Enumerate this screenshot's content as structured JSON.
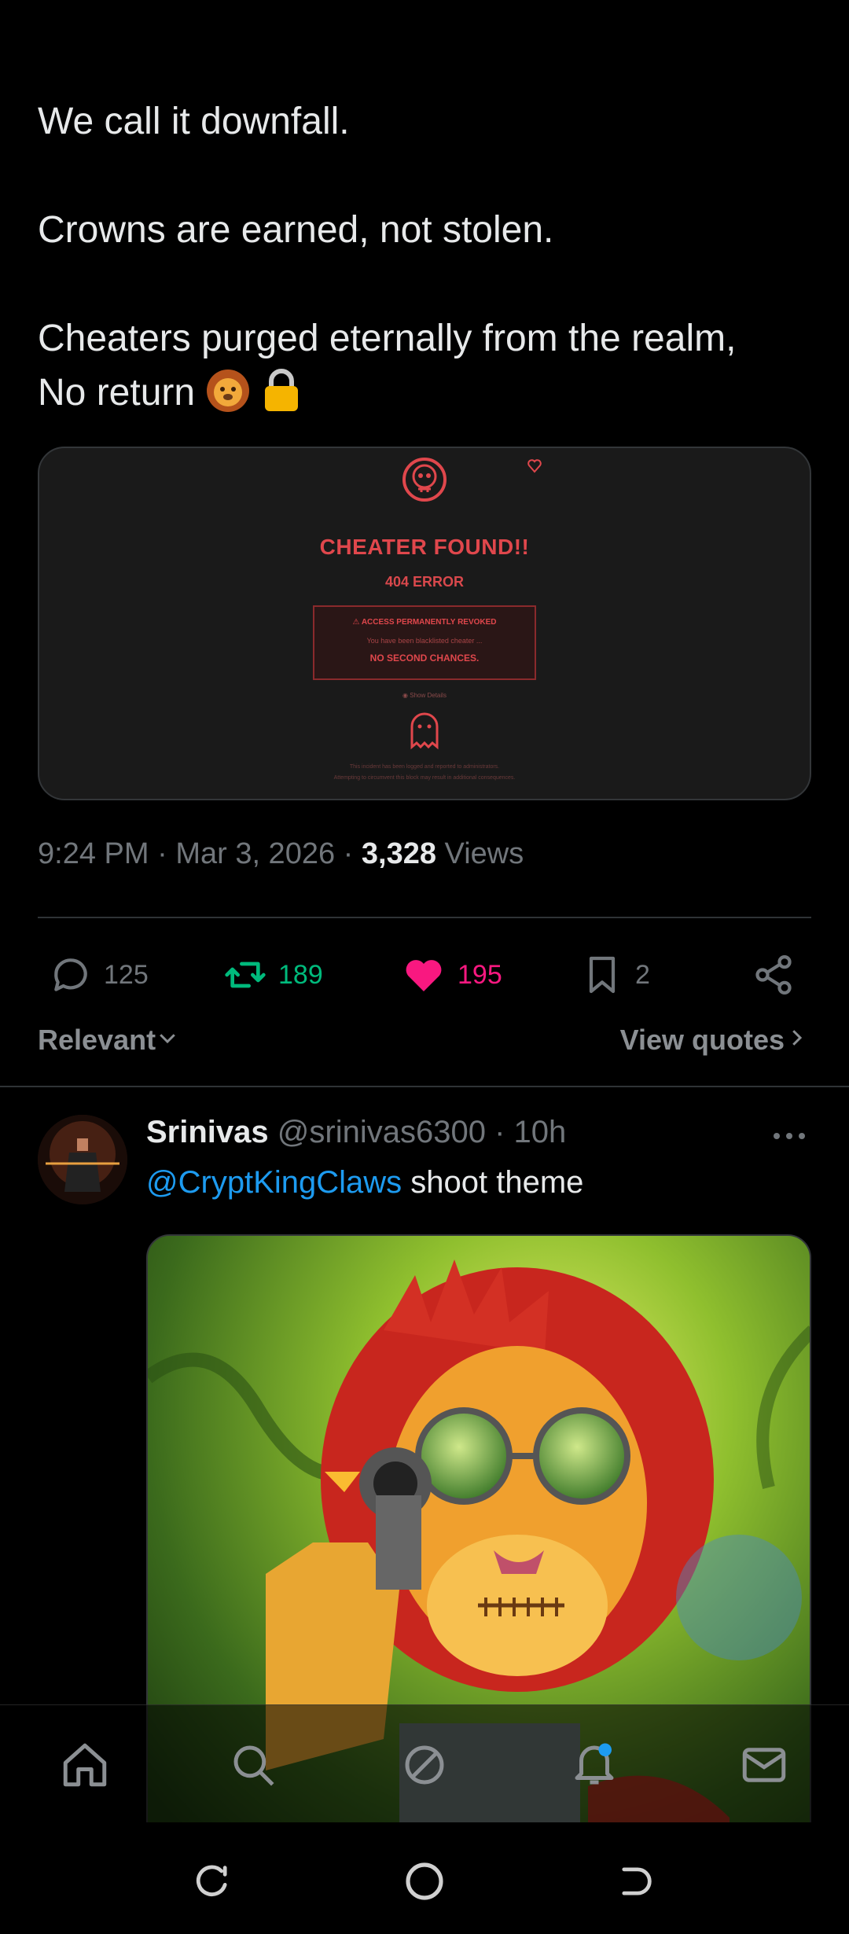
{
  "tweet": {
    "lines": [
      "We call it downfall.",
      "Crowns are earned, not stolen.",
      "Cheaters purged eternally from the realm,",
      "No return"
    ],
    "emojis": [
      "lion-face",
      "lock"
    ],
    "card": {
      "title": "CHEATER FOUND!!",
      "error_code": "404 ERROR",
      "box_line1": "ACCESS PERMANENTLY REVOKED",
      "box_line2": "You have been blacklisted cheater ...",
      "box_line3": "NO SECOND CHANCES.",
      "details_label": "Show Details",
      "footer1": "This incident has been logged and reported to administrators.",
      "footer2": "Attempting to circumvent this block may result in additional consequences."
    },
    "time": "9:24 PM",
    "date": "Mar 3, 2026",
    "views_count": "3,328",
    "views_label": "Views",
    "replies": "125",
    "reposts": "189",
    "likes": "195",
    "bookmarks": "2"
  },
  "sort": {
    "relevant_label": "Relevant",
    "view_quotes_label": "View quotes"
  },
  "reply": {
    "name": "Srinivas",
    "handle": "@srinivas6300",
    "age": "10h",
    "mention": "@CryptKingClaws",
    "text": "shoot theme"
  },
  "colors": {
    "accent": "#1d9bf0",
    "repost": "#00ba7c",
    "like": "#f91880",
    "muted": "#71767b",
    "card_red": "#e0474c"
  },
  "nav": [
    "home-icon",
    "search-icon",
    "grok-icon",
    "notifications-icon",
    "messages-icon"
  ],
  "system_nav": [
    "recents-icon",
    "home-circle-icon",
    "back-icon"
  ]
}
